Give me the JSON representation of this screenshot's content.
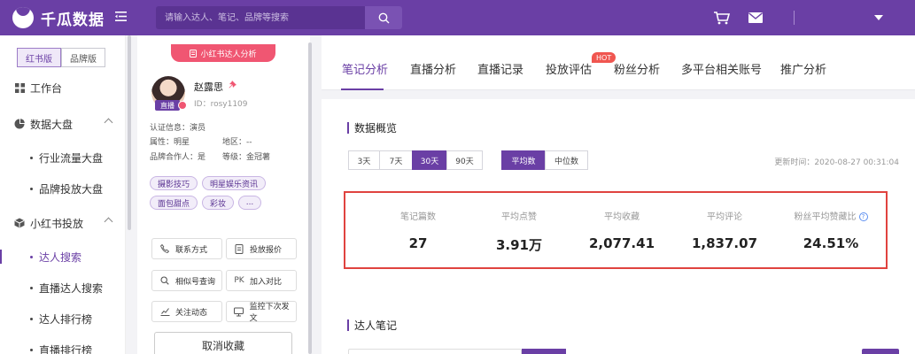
{
  "header": {
    "logo_text": "千瓜数据",
    "search_placeholder": "请输入达人、笔记、品牌等搜索"
  },
  "sidebar": {
    "versions": [
      "红书版",
      "品牌版"
    ],
    "items": [
      {
        "label": "工作台"
      },
      {
        "label": "数据大盘"
      },
      {
        "label": "行业流量大盘"
      },
      {
        "label": "品牌投放大盘"
      },
      {
        "label": "小红书投放"
      },
      {
        "label": "达人搜索"
      },
      {
        "label": "直播达人搜索"
      },
      {
        "label": "达人排行榜"
      },
      {
        "label": "直播排行榜"
      }
    ]
  },
  "profile": {
    "banner": "小红书达人分析",
    "live_tag": "直播",
    "name": "赵露思",
    "id": "ID：rosy1109",
    "cert": "认证信息：演员",
    "attr": "属性：明星",
    "region": "地区：--",
    "brand_partner": "品牌合作人：是",
    "level": "等级：金冠薯",
    "tags": [
      "摄影技巧",
      "明星娱乐资讯",
      "面包甜点",
      "彩妆",
      "..."
    ],
    "actions": [
      "联系方式",
      "投放报价",
      "相似号查询",
      "加入对比",
      "关注动态",
      "监控下次发文"
    ],
    "pk_label": "PK",
    "cancel": "取消收藏"
  },
  "tabs": [
    {
      "label": "笔记分析"
    },
    {
      "label": "直播分析"
    },
    {
      "label": "直播记录"
    },
    {
      "label": "投放评估"
    },
    {
      "label": "粉丝分析"
    },
    {
      "label": "多平台相关账号"
    },
    {
      "label": "推广分析"
    }
  ],
  "hot_badge": "HOT",
  "overview": {
    "title": "数据概览",
    "periods": [
      "3天",
      "7天",
      "30天",
      "90天"
    ],
    "modes": [
      "平均数",
      "中位数"
    ],
    "update_time": "更新时间：2020-08-27 00:31:04",
    "metrics": [
      {
        "label": "笔记篇数",
        "value": "27"
      },
      {
        "label": "平均点赞",
        "value": "3.91万"
      },
      {
        "label": "平均收藏",
        "value": "2,077.41"
      },
      {
        "label": "平均评论",
        "value": "1,837.07"
      },
      {
        "label": "粉丝平均赞藏比",
        "value": "24.51%"
      }
    ],
    "help_glyph": "?"
  },
  "notes": {
    "title": "达人笔记"
  }
}
